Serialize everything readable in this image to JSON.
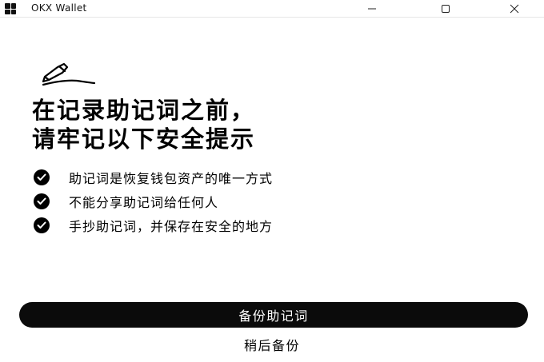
{
  "window": {
    "title": "OKX Wallet",
    "controls": {
      "minimize": "minimize-icon",
      "maximize": "maximize-icon",
      "close": "close-icon"
    }
  },
  "main": {
    "icon": "pen-signature-icon",
    "headline_line1": "在记录助记词之前，",
    "headline_line2": "请牢记以下安全提示",
    "tips": [
      "助记词是恢复钱包资产的唯一方式",
      "不能分享助记词给任何人",
      "手抄助记词，并保存在安全的地方"
    ]
  },
  "actions": {
    "primary_label": "备份助记词",
    "secondary_label": "稍后备份"
  },
  "colors": {
    "background": "#ffffff",
    "primary": "#0b0b0b",
    "text": "#000000"
  }
}
